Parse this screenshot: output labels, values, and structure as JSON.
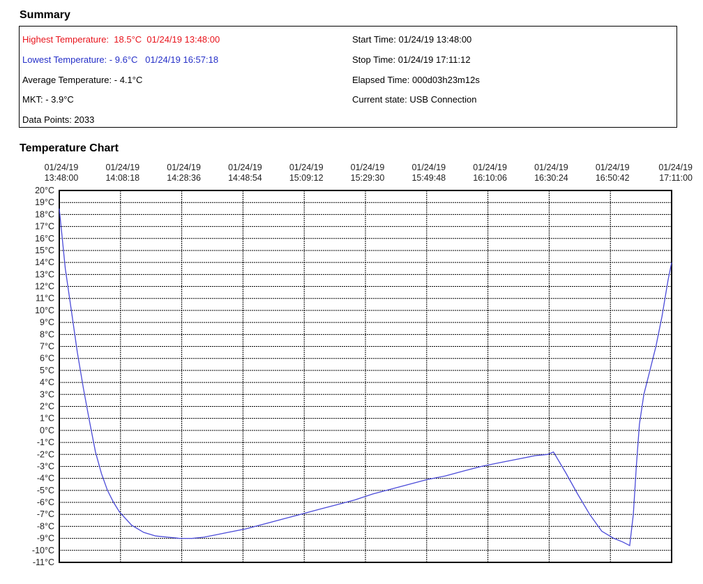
{
  "summary": {
    "title": "Summary",
    "highest_label": "Highest Temperature:",
    "highest_value": "18.5°C",
    "highest_time": "01/24/19 13:48:00",
    "lowest_label": "Lowest Temperature:",
    "lowest_value": "- 9.6°C",
    "lowest_time": "01/24/19 16:57:18",
    "average": "Average Temperature: - 4.1°C",
    "mkt": "MKT: - 3.9°C",
    "data_points": "Data Points: 2033",
    "start_time": "Start Time: 01/24/19 13:48:00",
    "stop_time": "Stop Time: 01/24/19 17:11:12",
    "elapsed_time": "Elapsed Time: 000d03h23m12s",
    "current_state": "Current state: USB Connection"
  },
  "chart_title": "Temperature Chart",
  "colors": {
    "highest": "#e8141c",
    "lowest": "#2630c8",
    "line": "#4a4ad8",
    "grid": "#000000"
  },
  "chart_data": {
    "type": "line",
    "title": "Temperature Chart",
    "xlabel": "",
    "ylabel": "",
    "ylim": [
      -11,
      20
    ],
    "y_unit": "°C",
    "y_ticks": [
      "20°C",
      "19°C",
      "18°C",
      "17°C",
      "16°C",
      "15°C",
      "14°C",
      "13°C",
      "12°C",
      "11°C",
      "10°C",
      "9°C",
      "8°C",
      "7°C",
      "6°C",
      "5°C",
      "4°C",
      "3°C",
      "2°C",
      "1°C",
      "0°C",
      "-1°C",
      "-2°C",
      "-3°C",
      "-4°C",
      "-5°C",
      "-6°C",
      "-7°C",
      "-8°C",
      "-9°C",
      "-10°C",
      "-11°C"
    ],
    "x_ticks": [
      {
        "date": "01/24/19",
        "time": "13:48:00"
      },
      {
        "date": "01/24/19",
        "time": "14:08:18"
      },
      {
        "date": "01/24/19",
        "time": "14:28:36"
      },
      {
        "date": "01/24/19",
        "time": "14:48:54"
      },
      {
        "date": "01/24/19",
        "time": "15:09:12"
      },
      {
        "date": "01/24/19",
        "time": "15:29:30"
      },
      {
        "date": "01/24/19",
        "time": "15:49:48"
      },
      {
        "date": "01/24/19",
        "time": "16:10:06"
      },
      {
        "date": "01/24/19",
        "time": "16:30:24"
      },
      {
        "date": "01/24/19",
        "time": "16:50:42"
      },
      {
        "date": "01/24/19",
        "time": "17:11:00"
      }
    ],
    "xlim": [
      "13:48:00",
      "17:11:12"
    ],
    "grid": true,
    "series": [
      {
        "x": [
          "13:48:00",
          "13:49:00",
          "13:50:00",
          "13:52:00",
          "13:54:00",
          "13:56:00",
          "13:58:00",
          "14:00:00",
          "14:02:00",
          "14:04:00",
          "14:06:00",
          "14:08:00",
          "14:12:00",
          "14:16:00",
          "14:20:00",
          "14:24:00",
          "14:28:00",
          "14:32:00",
          "14:36:00",
          "14:40:00",
          "14:44:00",
          "14:50:00",
          "14:56:00",
          "15:02:00",
          "15:08:00",
          "15:14:00",
          "15:20:00",
          "15:26:00",
          "15:32:00",
          "15:38:00",
          "15:44:00",
          "15:50:00",
          "15:56:00",
          "16:02:00",
          "16:08:00",
          "16:14:00",
          "16:20:00",
          "16:26:00",
          "16:30:00",
          "16:32:00",
          "16:36:00",
          "16:40:00",
          "16:44:00",
          "16:48:00",
          "16:52:00",
          "16:55:00",
          "16:57:18",
          "16:58:30",
          "16:59:30",
          "17:00:30",
          "17:02:00",
          "17:04:00",
          "17:06:00",
          "17:08:00",
          "17:10:00",
          "17:11:12"
        ],
        "values": [
          18.5,
          16.0,
          13.5,
          10.0,
          6.5,
          3.5,
          0.8,
          -1.8,
          -3.6,
          -5.0,
          -6.0,
          -6.8,
          -7.9,
          -8.5,
          -8.8,
          -8.9,
          -9.0,
          -9.0,
          -8.9,
          -8.7,
          -8.5,
          -8.2,
          -7.8,
          -7.4,
          -7.0,
          -6.6,
          -6.2,
          -5.8,
          -5.3,
          -4.9,
          -4.5,
          -4.1,
          -3.8,
          -3.4,
          -3.0,
          -2.7,
          -2.4,
          -2.1,
          -2.0,
          -1.8,
          -3.5,
          -5.3,
          -7.0,
          -8.4,
          -9.0,
          -9.3,
          -9.6,
          -7.0,
          -3.0,
          0.5,
          3.0,
          5.0,
          7.0,
          9.5,
          12.5,
          14.0
        ]
      }
    ]
  }
}
